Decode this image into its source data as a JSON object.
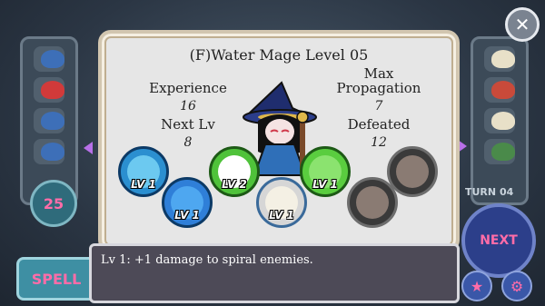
{
  "header": {
    "title": "(F)Water Mage Level 05"
  },
  "stats": {
    "experience_label": "Experience",
    "experience_value": "16",
    "next_lv_label": "Next Lv",
    "next_lv_value": "8",
    "max_prop_label_line1": "Max",
    "max_prop_label_line2": "Propagation",
    "max_prop_value": "7",
    "defeated_label": "Defeated",
    "defeated_value": "12"
  },
  "skills": [
    {
      "level": "LV 1",
      "color": "#2b8fd0",
      "icon": "water-wave-icon"
    },
    {
      "level": "LV 1",
      "color": "#2f7fd8",
      "icon": "water-drop-icon"
    },
    {
      "level": "LV 2",
      "color": "#4fc23a",
      "icon": "checkered-flag-icon"
    },
    {
      "level": "LV 1",
      "color": "#d6d6d6",
      "icon": "ram-target-icon"
    },
    {
      "level": "LV 1",
      "color": "#5acd3f",
      "icon": "spiral-orb-icon"
    },
    {
      "level": "",
      "color": "#3a3a3a",
      "icon": "empty-slot-icon"
    },
    {
      "level": "",
      "color": "#3a3a3a",
      "icon": "empty-slot-icon"
    }
  ],
  "description": "Lv 1: +1 damage to spiral enemies.",
  "hud": {
    "counter": "25",
    "spell": "SPELL",
    "turn": "TURN 04",
    "next": "NEXT",
    "close": "✕"
  },
  "colors": {
    "accent_pink": "#ff6ca8",
    "arrow_purple": "#b870e8",
    "panel_bg": "#e6e6e6",
    "textbox_bg": "#4d4a57"
  }
}
